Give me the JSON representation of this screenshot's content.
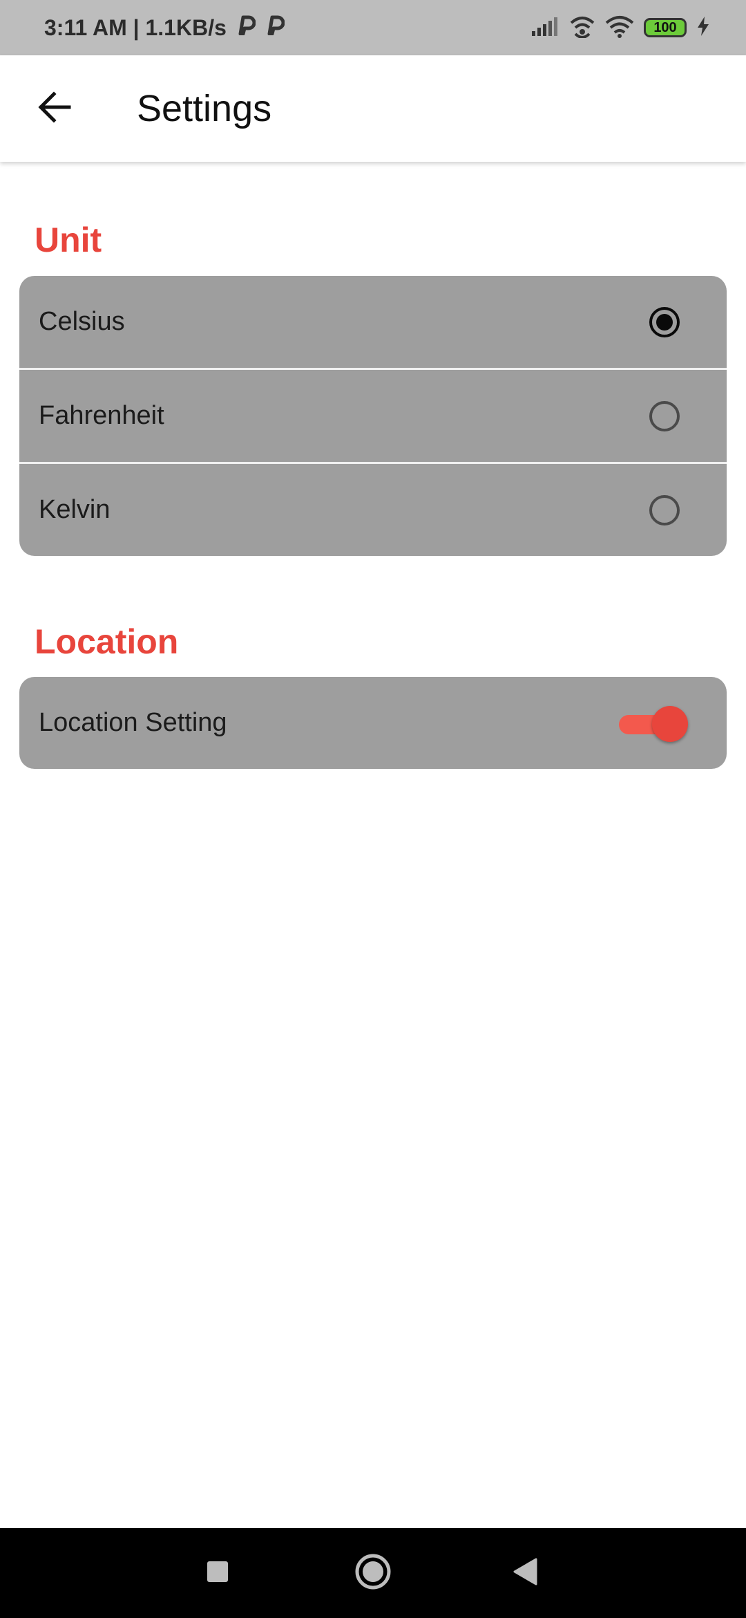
{
  "status_bar": {
    "time_speed": "3:11 AM | 1.1KB/s",
    "battery_level": "100",
    "icons": [
      "parking-icon",
      "parking-icon",
      "signal-icon",
      "wifi-hotspot-icon",
      "wifi-icon",
      "battery-icon",
      "charging-icon"
    ]
  },
  "app_bar": {
    "title": "Settings",
    "back_icon": "arrow-left-icon"
  },
  "sections": {
    "unit": {
      "title": "Unit",
      "options": [
        {
          "label": "Celsius",
          "selected": true
        },
        {
          "label": "Fahrenheit",
          "selected": false
        },
        {
          "label": "Kelvin",
          "selected": false
        }
      ]
    },
    "location": {
      "title": "Location",
      "setting_label": "Location Setting",
      "enabled": true
    }
  },
  "colors": {
    "accent": "#e8453c",
    "card": "#9e9e9e",
    "status_bar": "#bdbdbd"
  },
  "nav_bar": {
    "icons": [
      "recents-square-icon",
      "home-circle-icon",
      "back-triangle-icon"
    ]
  }
}
